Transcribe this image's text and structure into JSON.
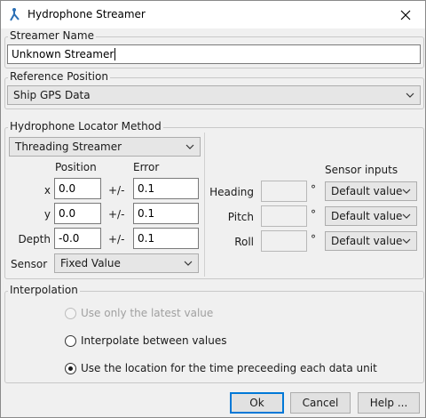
{
  "window": {
    "title": "Hydrophone Streamer"
  },
  "streamer_name": {
    "legend": "Streamer Name",
    "value": "Unknown Streamer"
  },
  "reference_position": {
    "legend": "Reference Position",
    "selected": "Ship GPS Data"
  },
  "locator": {
    "legend": "Hydrophone Locator Method",
    "method_selected": "Threading Streamer",
    "position_header": "Position",
    "error_header": "Error",
    "pm": "+/-",
    "rows": [
      {
        "label": "x",
        "position": "0.0",
        "error": "0.1"
      },
      {
        "label": "y",
        "position": "0.0",
        "error": "0.1"
      },
      {
        "label": "Depth",
        "position": "-0.0",
        "error": "0.1"
      }
    ],
    "sensor_label": "Sensor",
    "sensor_selected": "Fixed Value",
    "sensor_inputs_header": "Sensor inputs",
    "degree": "°",
    "orientation": [
      {
        "label": "Heading",
        "value": "",
        "input": "Default value"
      },
      {
        "label": "Pitch",
        "value": "",
        "input": "Default value"
      },
      {
        "label": "Roll",
        "value": "",
        "input": "Default value"
      }
    ]
  },
  "interpolation": {
    "legend": "Interpolation",
    "options": [
      {
        "label": "Use only the latest value",
        "enabled": false,
        "checked": false
      },
      {
        "label": "Interpolate between values",
        "enabled": true,
        "checked": false
      },
      {
        "label": "Use the location for the time preceeding each data unit",
        "enabled": true,
        "checked": true
      }
    ]
  },
  "buttons": {
    "ok": "Ok",
    "cancel": "Cancel",
    "help": "Help ..."
  },
  "colors": {
    "accent": "#0078d7",
    "icon": "#2b6fb5"
  }
}
